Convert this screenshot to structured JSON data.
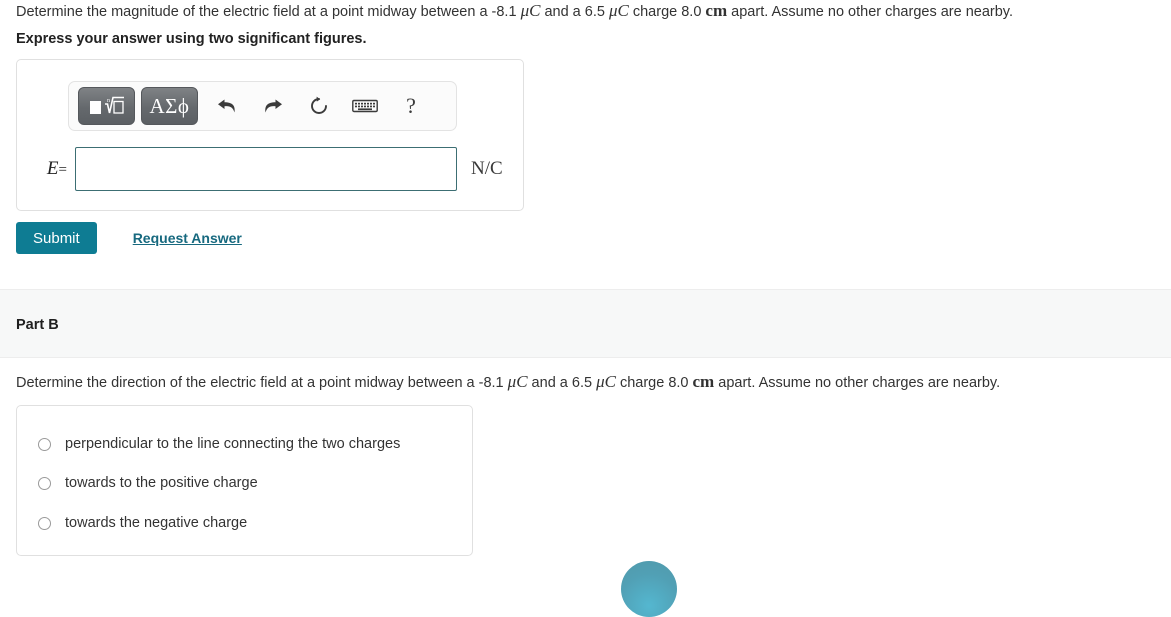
{
  "part_a": {
    "question_prefix": "Determine the magnitude of the electric field at a point midway between a -8.1 ",
    "unit_charge_1": "μC",
    "question_mid": " and a 6.5 ",
    "unit_charge_2": "μC",
    "question_mid2": " charge 8.0 ",
    "unit_distance": "cm",
    "question_suffix": " apart. Assume no other charges are nearby.",
    "instruction": "Express your answer using two significant figures.",
    "answer_variable": "E",
    "equals_sign": "=",
    "answer_value": "",
    "answer_placeholder": "",
    "answer_unit": "N/C",
    "submit_label": "Submit",
    "request_answer_label": "Request Answer"
  },
  "toolbar": {
    "template_button": "math-template-icon",
    "greek_button_label": "ΑΣϕ",
    "undo_label": "undo-arrow-icon",
    "redo_label": "redo-arrow-icon",
    "reset_label": "reset-refresh-icon",
    "keyboard_label": "keyboard-icon",
    "help_label": "?"
  },
  "part_b": {
    "title": "Part B",
    "question_prefix": "Determine the direction of the electric field at a point midway between a -8.1 ",
    "unit_charge_1": "μC",
    "question_mid": " and a 6.5 ",
    "unit_charge_2": "μC",
    "question_mid2": " charge 8.0 ",
    "unit_distance": "cm",
    "question_suffix": " apart. Assume no other charges are nearby.",
    "choices": [
      {
        "label": "perpendicular to the line connecting the two charges",
        "selected": false
      },
      {
        "label": "towards to the positive charge",
        "selected": false
      },
      {
        "label": "towards the negative charge",
        "selected": false
      }
    ]
  },
  "colors": {
    "accent_teal": "#0e7c93",
    "link_teal": "#17697f",
    "input_border": "#3c6e73",
    "band_background": "#f7f8f8"
  }
}
